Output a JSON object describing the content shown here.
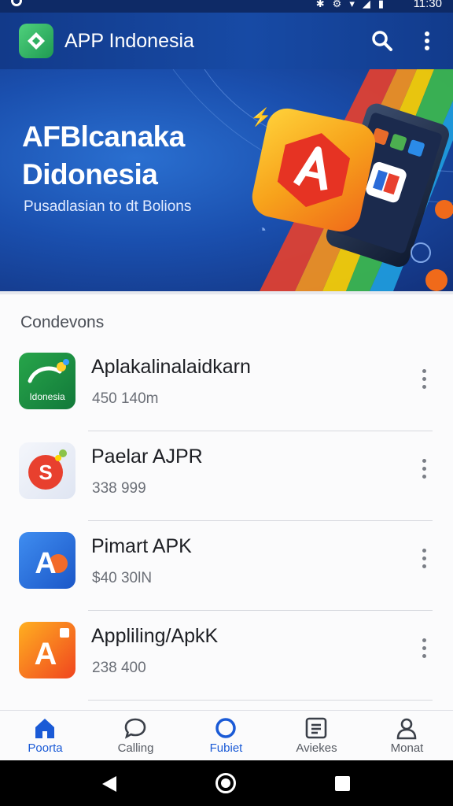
{
  "status_bar": {
    "time": "11:30",
    "icons": [
      "bluetooth-icon",
      "settings-icon",
      "wifi-icon",
      "signal-icon",
      "battery-icon"
    ]
  },
  "app_bar": {
    "title": "APP Indonesia",
    "logo": "app-logo-icon",
    "actions": [
      "search-icon",
      "more-vert-icon"
    ],
    "color": "#174aa5"
  },
  "banner": {
    "title_line1": "AFBlcanaka",
    "title_line2": "Didonesia",
    "subtitle": "Pusadlasian to dt Bolions"
  },
  "section": {
    "title": "Condevons"
  },
  "apps": [
    {
      "name": "Aplakalinalaidkarn",
      "meta": "450 140m",
      "icon": "indonesia-app-icon",
      "icon_text": "Idonesia"
    },
    {
      "name": "Paelar AJPR",
      "meta": "338 999",
      "icon": "s-app-icon",
      "icon_text": "S"
    },
    {
      "name": "Pimart APK",
      "meta": "$40 30lN",
      "icon": "a-blue-app-icon",
      "icon_text": "A"
    },
    {
      "name": "Appliling/ApkK",
      "meta": "238 400",
      "icon": "a-orange-app-icon",
      "icon_text": "A"
    }
  ],
  "bottom_nav": [
    {
      "label": "Poorta",
      "icon": "home-icon",
      "active": true
    },
    {
      "label": "Calling",
      "icon": "chat-icon",
      "active": false
    },
    {
      "label": "Fubiet",
      "icon": "circle-icon",
      "active": false
    },
    {
      "label": "Aviekes",
      "icon": "list-icon",
      "active": false
    },
    {
      "label": "Monat",
      "icon": "profile-icon",
      "active": false
    }
  ],
  "accent_color": "#1a5ad6"
}
